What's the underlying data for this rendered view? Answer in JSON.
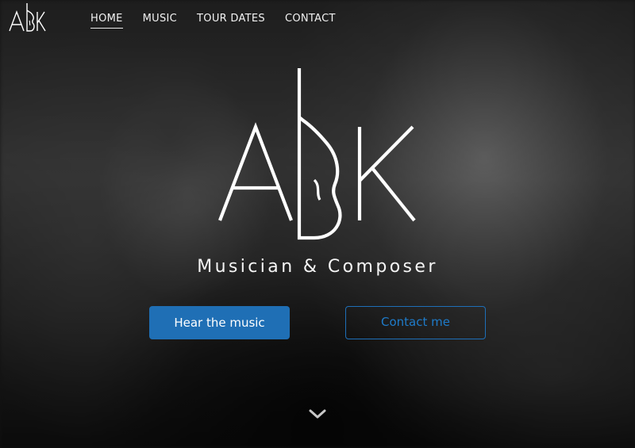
{
  "nav": {
    "logo_text": "ABK",
    "links": [
      {
        "label": "HOME",
        "active": true
      },
      {
        "label": "MUSIC",
        "active": false
      },
      {
        "label": "TOUR DATES",
        "active": false
      },
      {
        "label": "CONTACT",
        "active": false
      }
    ]
  },
  "hero": {
    "logo_text": "ABK",
    "tagline": "Musician & Composer",
    "primary_button": "Hear the music",
    "secondary_button": "Contact me"
  },
  "icons": {
    "scroll": "chevron-down-icon"
  },
  "colors": {
    "accent": "#1f6fb5",
    "text": "#ffffff"
  }
}
